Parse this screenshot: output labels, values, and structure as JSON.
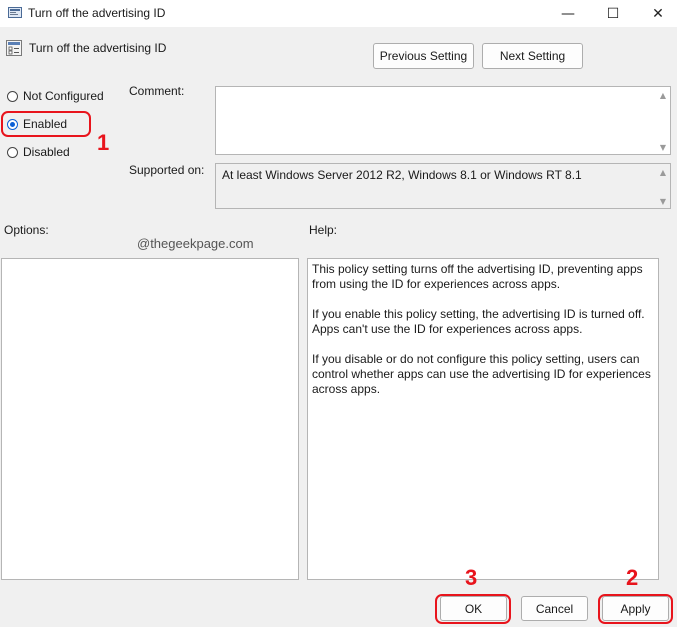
{
  "window": {
    "title": "Turn off the advertising ID",
    "icon": "policy-window-icon",
    "minimize_glyph": "—",
    "maximize_glyph": "☐",
    "close_glyph": "✕"
  },
  "header": {
    "policy_name": "Turn off the advertising ID",
    "previous_label": "Previous Setting",
    "next_label": "Next Setting"
  },
  "state": {
    "options": [
      {
        "label": "Not Configured",
        "checked": false
      },
      {
        "label": "Enabled",
        "checked": true
      },
      {
        "label": "Disabled",
        "checked": false
      }
    ]
  },
  "comment": {
    "label": "Comment:",
    "value": ""
  },
  "supported": {
    "label": "Supported on:",
    "value": "At least Windows Server 2012 R2, Windows 8.1 or Windows RT 8.1"
  },
  "sections": {
    "options_label": "Options:",
    "help_label": "Help:"
  },
  "watermark": "@thegeekpage.com",
  "help": {
    "paragraphs": [
      "This policy setting turns off the advertising ID, preventing apps from using the ID for experiences across apps.",
      "If you enable this policy setting, the advertising ID is turned off. Apps can't use the ID for experiences across apps.",
      "If you disable or do not configure this policy setting, users can control whether apps can use the advertising ID for experiences across apps."
    ]
  },
  "footer": {
    "ok_label": "OK",
    "cancel_label": "Cancel",
    "apply_label": "Apply"
  },
  "annotations": {
    "step1": "1",
    "step2": "2",
    "step3": "3",
    "color": "#e8141c"
  }
}
